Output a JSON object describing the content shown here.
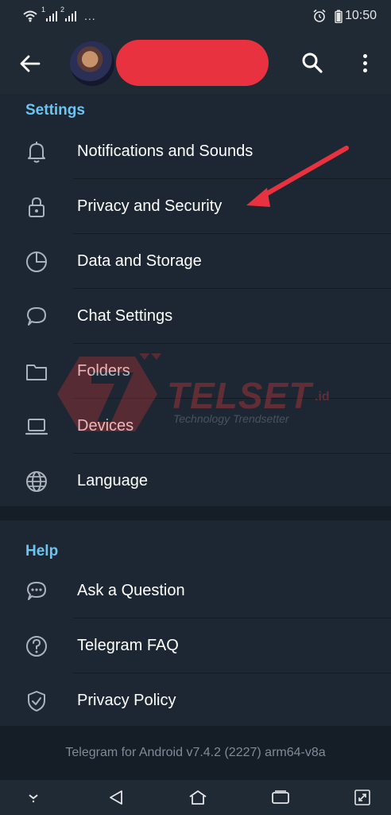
{
  "status_bar": {
    "time": "10:50",
    "dots": "...",
    "sim1": "1",
    "sim2": "2"
  },
  "header": {
    "back_icon": "arrow-left-icon",
    "search_icon": "search-icon",
    "menu_icon": "kebab-menu-icon"
  },
  "settings": {
    "title": "Settings",
    "items": [
      {
        "label": "Notifications and Sounds",
        "icon": "bell-icon"
      },
      {
        "label": "Privacy and Security",
        "icon": "lock-icon"
      },
      {
        "label": "Data and Storage",
        "icon": "pie-chart-icon"
      },
      {
        "label": "Chat Settings",
        "icon": "chat-bubble-icon"
      },
      {
        "label": "Folders",
        "icon": "folder-icon"
      },
      {
        "label": "Devices",
        "icon": "laptop-icon"
      },
      {
        "label": "Language",
        "icon": "globe-icon"
      }
    ]
  },
  "help": {
    "title": "Help",
    "items": [
      {
        "label": "Ask a Question",
        "icon": "chat-dots-icon"
      },
      {
        "label": "Telegram FAQ",
        "icon": "question-circle-icon"
      },
      {
        "label": "Privacy Policy",
        "icon": "shield-check-icon"
      }
    ]
  },
  "footer": {
    "version": "Telegram for Android v7.4.2 (2227) arm64-v8a"
  },
  "watermark": {
    "brand": "TELSET",
    "suffix": ".id",
    "tagline": "Technology Trendsetter"
  },
  "colors": {
    "accent": "#6cc4f0",
    "background": "#1d2733",
    "header": "#1f2a34",
    "redaction": "#e8323f",
    "arrow": "#e8323f"
  }
}
